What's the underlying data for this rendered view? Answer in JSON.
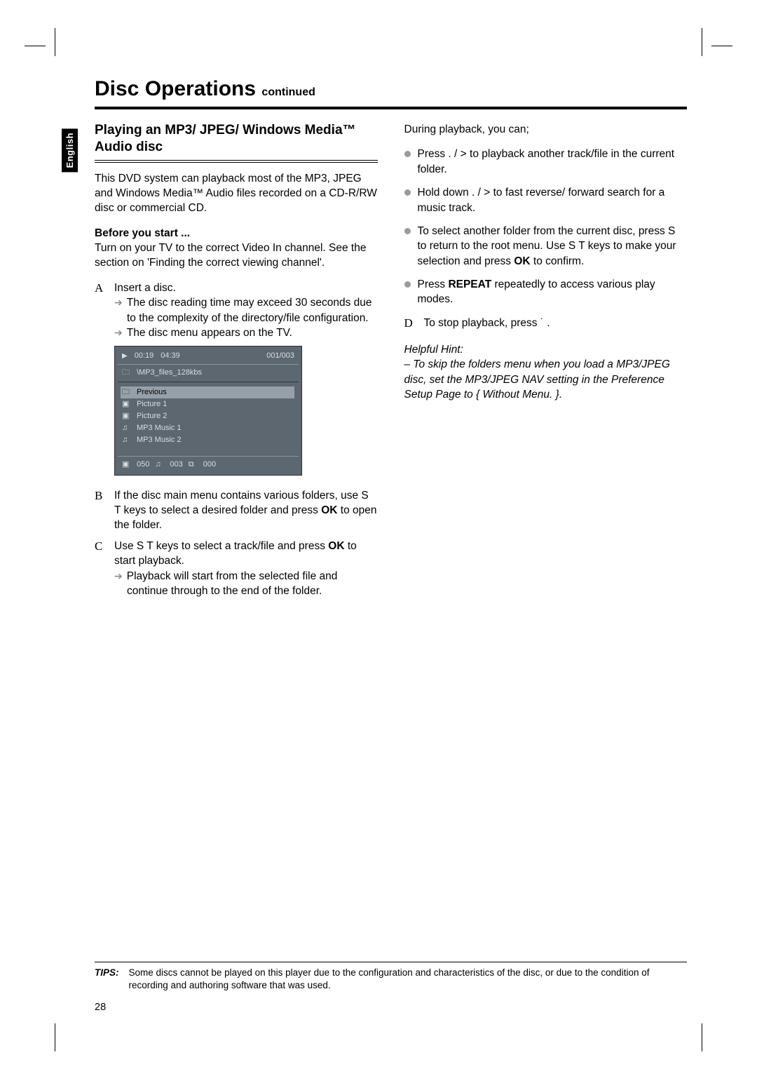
{
  "lang_tab": "English",
  "page_title_main": "Disc Operations",
  "page_title_cont": "continued",
  "section_heading": "Playing an MP3/ JPEG/ Windows Media™ Audio disc",
  "intro_para": "This DVD system can playback most of the MP3, JPEG and Windows Media™ Audio files recorded on a CD-R/RW disc or commercial CD.",
  "before_you_start_label": "Before you start ...",
  "before_you_start_body": "Turn on your TV to the correct Video In channel.  See the section on 'Finding the correct viewing channel'.",
  "steps": {
    "a": {
      "letter": "A",
      "text": "Insert a disc.",
      "arrow1": "The disc reading time may exceed 30 seconds due to the complexity of the directory/file configuration.",
      "arrow2": "The disc menu appears on the TV."
    },
    "b": {
      "letter": "B",
      "text_prefix": "If the disc main menu contains various folders, use  S T  keys to select a desired folder and press ",
      "ok": "OK",
      "text_suffix": " to open the folder."
    },
    "c": {
      "letter": "C",
      "text_prefix": "Use  S T  keys to select a track/file and press ",
      "ok": "OK",
      "text_suffix": " to start playback.",
      "arrow1": "Playback will start from the selected file and continue through to the end of the folder."
    },
    "d": {
      "letter": "D",
      "text": "To stop playback, press  ˙    ."
    }
  },
  "right_intro": "During playback, you can;",
  "bullets": {
    "b1": "Press .        / >       to playback another track/file in the current folder.",
    "b2": "Hold down .        / >       to fast reverse/ forward search for a music track.",
    "b3_prefix": "To select another folder from the current disc, press  S  to return to the root menu.  Use  S T  keys to make your selection and press ",
    "b3_ok": "OK",
    "b3_suffix": " to confirm.",
    "b4_prefix": "Press ",
    "b4_repeat": "REPEAT",
    "b4_suffix": " repeatedly to access various play modes."
  },
  "hint_label": "Helpful Hint:",
  "hint_body": "– To skip the folders menu when you load a MP3/JPEG disc, set the MP3/JPEG NAV setting in the Preference Setup Page to { Without Menu. }.",
  "disc_menu": {
    "time_elapsed": "00:19",
    "time_total": "04:39",
    "track_index": "001/003",
    "path": "\\MP3_files_128kbs",
    "previous": "Previous",
    "items": [
      {
        "icon": "pic",
        "label": "Picture 1"
      },
      {
        "icon": "pic",
        "label": "Picture 2"
      },
      {
        "icon": "music",
        "label": "MP3 Music 1"
      },
      {
        "icon": "music",
        "label": "MP3 Music 2"
      }
    ],
    "status_pic": "050",
    "status_music": "003",
    "status_vid": "000"
  },
  "tips_label": "TIPS:",
  "tips_body": "Some discs cannot be played on this player due to the configuration and characteristics of the disc, or due to the condition of recording and authoring software that was used.",
  "page_number": "28"
}
